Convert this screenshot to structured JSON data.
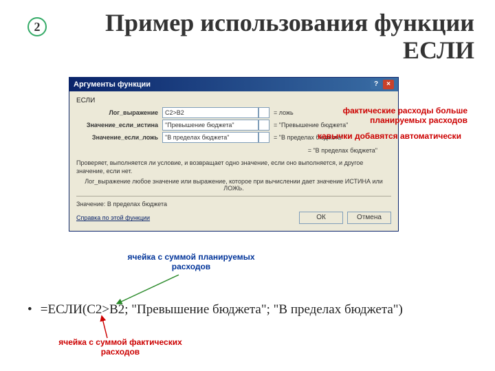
{
  "slide": {
    "number": "2",
    "title": "Пример использования функции ЕСЛИ"
  },
  "dialog": {
    "title": "Аргументы функции",
    "fn": "ЕСЛИ",
    "args": {
      "logical": {
        "label": "Лог_выражение",
        "value": "C2>B2",
        "eval": "= ложь"
      },
      "if_true": {
        "label": "Значение_если_истина",
        "value": "\"Превышение бюджета\"",
        "eval": "= \"Превышение бюджета\""
      },
      "if_false": {
        "label": "Значение_если_ложь",
        "value": "\"В пределах бюджета\"",
        "eval": "= \"В пределах бюджета\""
      }
    },
    "result_preview": "= \"В пределах бюджета\"",
    "description": "Проверяет, выполняется ли условие, и возвращает одно значение, если оно выполняется, и другое значение, если нет.",
    "description_sub": "Лог_выражение   любое значение или выражение, которое при вычислении дает значение ИСТИНА или ЛОЖЬ.",
    "eval_line": "Значение:  В пределах бюджета",
    "help_link": "Справка по этой функции",
    "ok": "ОК",
    "cancel": "Отмена"
  },
  "annotations": {
    "a1": "фактические расходы больше планируемых расходов",
    "a2": "кавычки добавятся автоматически",
    "a3": "ячейка с суммой планируемых расходов",
    "a4": "ячейка с суммой фактических расходов"
  },
  "formula": "=ЕСЛИ(C2>B2; \"Превышение бюджета\"; \"В пределах бюджета\")"
}
